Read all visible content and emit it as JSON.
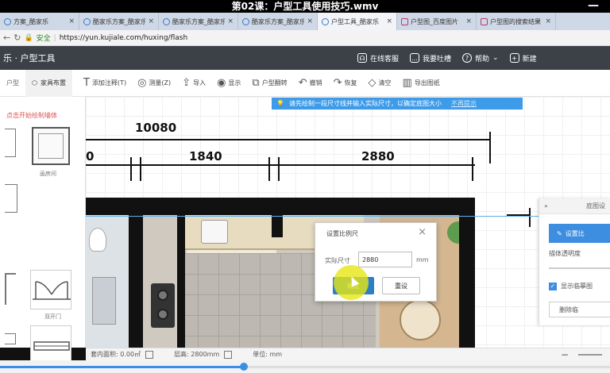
{
  "video": {
    "title": "第02课：户型工具使用技巧.wmv",
    "minimize": "—",
    "progress": 0.4
  },
  "browser": {
    "tabs": [
      {
        "label": "方案_酷家乐",
        "active": false,
        "icon": "blue"
      },
      {
        "label": "酷家乐方案_酷家乐",
        "active": false,
        "icon": "blue"
      },
      {
        "label": "酷家乐方案_酷家乐",
        "active": false,
        "icon": "blue"
      },
      {
        "label": "酷家乐方案_酷家乐",
        "active": false,
        "icon": "blue"
      },
      {
        "label": "户型工具_酷家乐",
        "active": true,
        "icon": "blue"
      },
      {
        "label": "户型图_百度图片",
        "active": false,
        "icon": "red"
      },
      {
        "label": "户型图的搜索结果",
        "active": false,
        "icon": "red"
      }
    ],
    "secure_label": "安全",
    "url": "https://yun.kujiale.com/huxing/flash"
  },
  "appbar": {
    "title": "乐 · 户型工具",
    "actions": [
      {
        "label": "在线客服",
        "icon": "headset-icon"
      },
      {
        "label": "我要吐槽",
        "icon": "chat-icon"
      },
      {
        "label": "帮助",
        "icon": "help-icon"
      },
      {
        "label": "新建",
        "icon": "new-icon"
      }
    ]
  },
  "panel_tabs": [
    {
      "label": "户型",
      "active": false
    },
    {
      "label": "家具布置",
      "active": true
    }
  ],
  "tools": [
    {
      "icon": "T",
      "label": "添加注释(T)"
    },
    {
      "icon": "◎",
      "label": "测量(Z)"
    },
    {
      "icon": "⇪",
      "label": "导入"
    },
    {
      "icon": "◉",
      "label": "显示"
    },
    {
      "icon": "⧉",
      "label": "户型翻转"
    },
    {
      "icon": "↶",
      "label": "撤销"
    },
    {
      "icon": "↷",
      "label": "恢复"
    },
    {
      "icon": "◇",
      "label": "清空"
    },
    {
      "icon": "▥",
      "label": "导出图纸"
    }
  ],
  "sidebar": {
    "hint": "点击开始绘制墙体",
    "room_label": "画房间",
    "door_label": "双开门"
  },
  "notice": {
    "text": "请先绘制一段尺寸线并输入实际尺寸，以确定底图大小",
    "link": "不再提示"
  },
  "dimensions": {
    "total": "10080",
    "a": "1840",
    "b": "2880",
    "c": "0"
  },
  "dialog": {
    "title": "设置比例尺",
    "label": "实际尺寸",
    "value": "2880",
    "unit": "mm",
    "confirm": "确定",
    "reset": "重设"
  },
  "right_panel": {
    "header": "底图设",
    "button": "设置比",
    "opacity_label": "描体透明度",
    "checkbox_label": "显示临摹图",
    "delete_label": "删除临"
  },
  "status": {
    "area": "套内面积: 0.00㎡",
    "height": "层高: 2800mm",
    "unit": "单位: mm"
  }
}
